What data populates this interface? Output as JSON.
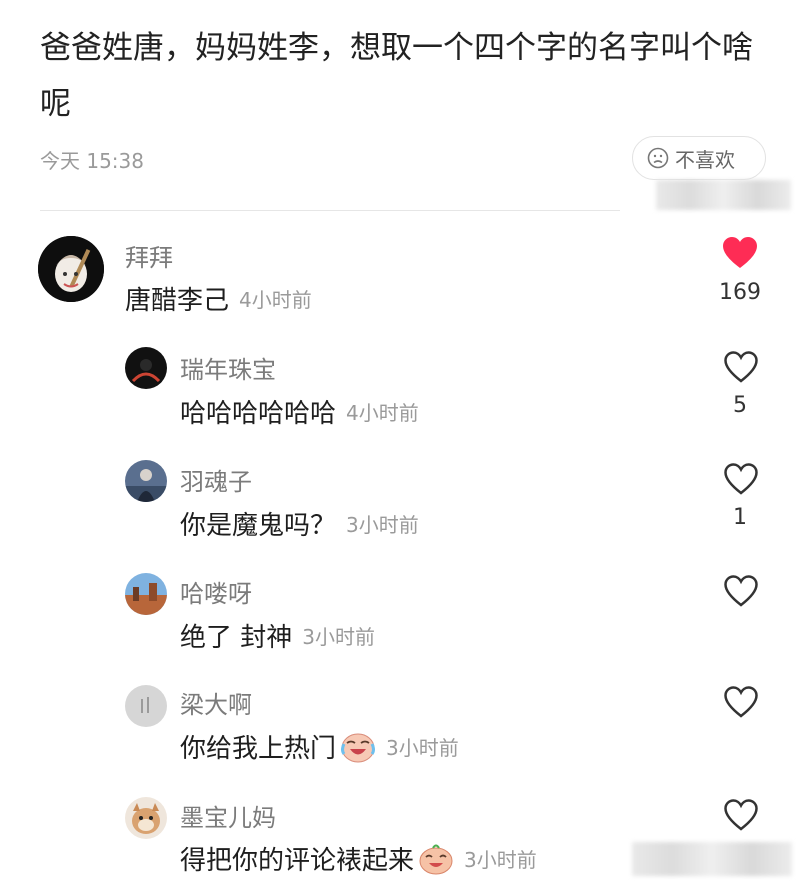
{
  "post": {
    "text": "爸爸姓唐，妈妈姓李，想取一个四个字的名字叫个啥呢",
    "time": "今天 15:38",
    "dislike_label": "不喜欢"
  },
  "colors": {
    "liked_heart": "#fe2c55",
    "muted_text": "#9a9a9a"
  },
  "comments": [
    {
      "author": "拜拜",
      "text": "唐醋李己",
      "time": "4小时前",
      "likes": "169",
      "liked": true,
      "avatar_icon": "anime-avatar"
    },
    {
      "author": "瑞年珠宝",
      "text": "哈哈哈哈哈哈",
      "time": "4小时前",
      "likes": "5",
      "liked": false,
      "avatar_icon": "dark-avatar"
    },
    {
      "author": "羽魂子",
      "text": "你是魔鬼吗？",
      "time": "3小时前",
      "likes": "1",
      "liked": false,
      "avatar_icon": "figure-avatar"
    },
    {
      "author": "哈喽呀",
      "text": "绝了 封神",
      "time": "3小时前",
      "likes": "",
      "liked": false,
      "avatar_icon": "scenery-avatar"
    },
    {
      "author": "梁大啊",
      "text": "你给我上热门",
      "time": "3小时前",
      "likes": "",
      "liked": false,
      "avatar_icon": "grey-avatar",
      "emoji": "crying-laugh-emoji"
    },
    {
      "author": "墨宝儿妈",
      "text": "得把你的评论裱起来",
      "time": "3小时前",
      "likes": "",
      "liked": false,
      "avatar_icon": "pet-avatar",
      "emoji": "laugh-emoji"
    }
  ]
}
